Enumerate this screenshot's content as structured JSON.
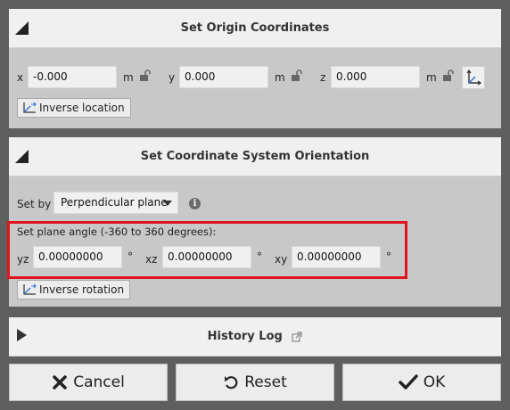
{
  "origin": {
    "title": "Set Origin Coordinates",
    "x_label": "x",
    "x_value": "-0.000",
    "y_label": "y",
    "y_value": "0.000",
    "z_label": "z",
    "z_value": "0.000",
    "unit": "m",
    "inverse_label": "Inverse location"
  },
  "orientation": {
    "title": "Set Coordinate System Orientation",
    "setby_label": "Set by",
    "setby_value": "Perpendicular plane",
    "info_glyph": "i",
    "plane_title": "Set plane angle (-360 to 360 degrees):",
    "yz_label": "yz",
    "yz_value": "0.00000000",
    "xz_label": "xz",
    "xz_value": "0.00000000",
    "xy_label": "xy",
    "xy_value": "0.00000000",
    "degree": "°",
    "inverse_label": "Inverse rotation"
  },
  "history": {
    "title": "History Log"
  },
  "footer": {
    "cancel_label": "Cancel",
    "reset_label": "Reset",
    "ok_label": "OK"
  },
  "colors": {
    "highlight": "#e0141e",
    "background": "#5f5f5f",
    "panel": "#c8c8c8",
    "header": "#f0f0f0"
  }
}
